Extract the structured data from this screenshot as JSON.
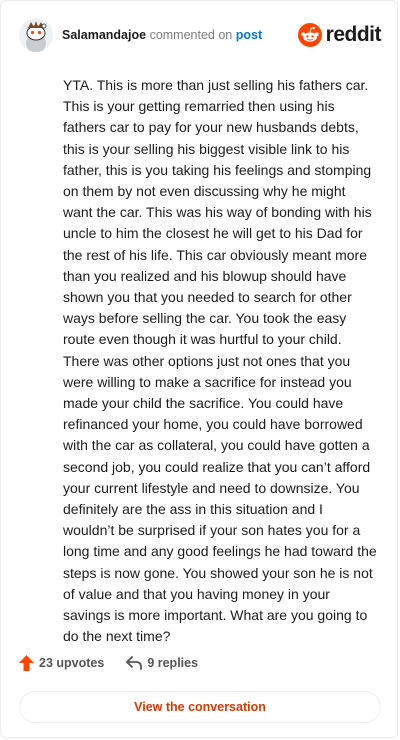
{
  "header": {
    "username": "Salamandajoe",
    "action": "commented on",
    "link": "post",
    "avatar_icon": "snoo-avatar-icon",
    "brand_icon": "reddit-logo-icon",
    "brand_name": "reddit",
    "brand_color": "#ff4500"
  },
  "comment": {
    "text": "YTA. This is more than just selling his fathers car. This is your getting remarried then using his fathers car to pay for your new husbands debts, this is your selling his biggest visible link to his father, this is you taking his feelings and stomping on them by not even discussing why he might want the car. This was his way of bonding with his uncle to him the closest he will get to his Dad for the rest of his life. This car obviously meant more than you realized and his blowup should have shown you that you needed to search for other ways before selling the car. You took the easy route even though it was hurtful to your child. There was other options just not ones that you were willing to make a sacrifice for instead you made your child the sacrifice. You could have refinanced your home, you could have borrowed with the car as collateral, you could have gotten a second job, you could realize that you can’t afford your current lifestyle and need to downsize. You definitely are the ass in this situation and I wouldn’t be surprised if your son hates you for a long time and any good feelings he had toward the steps is now gone. You showed your son he is not of value and that you having money in your savings is more important. What are you going to do the next time?"
  },
  "footer": {
    "upvotes": "23 upvotes",
    "replies": "9 replies",
    "upvote_icon": "upvote-arrow-icon",
    "reply_icon": "reply-arrow-icon",
    "view_button": "View the conversation",
    "accent_color": "#d93a00"
  }
}
